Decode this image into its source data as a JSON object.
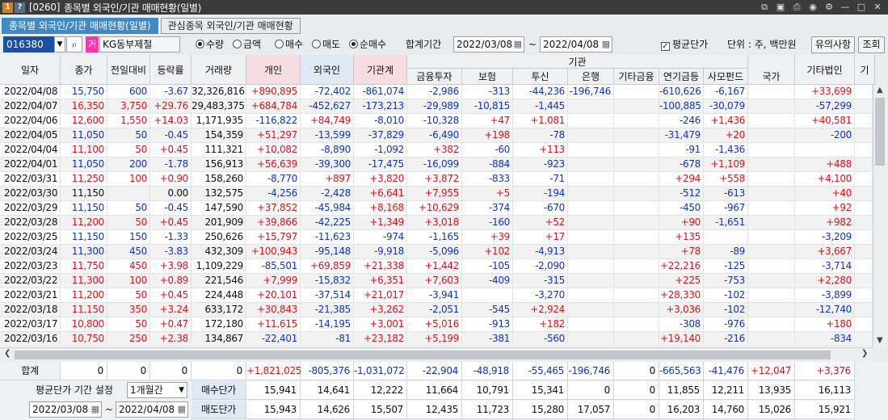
{
  "titlebar": {
    "screen_code": "[0260]",
    "title": "종목별 외국인/기관 매매현황(일별)",
    "icon1": "1",
    "icon2": "?"
  },
  "tabs": [
    "종목별 외국인/기관 매매현황(일별)",
    "관심종목 외국인/기관 매매현황"
  ],
  "toolbar": {
    "code": "016380",
    "mark": "거",
    "stock_name": "KG동부제철",
    "radio_qty": "수량",
    "radio_amt": "금액",
    "radio_buy": "매수",
    "radio_sell": "매도",
    "radio_net": "순매수",
    "period_label": "합계기간",
    "date_from": "2022/03/08",
    "tilde": "~",
    "date_to": "2022/04/08",
    "avg_label": "평균단가",
    "unit_label": "단위 : 주, 백만원",
    "notice_btn": "유의사항",
    "query_btn": "조회"
  },
  "columns": {
    "date": "일자",
    "close": "종가",
    "change": "전일대비",
    "rate": "등락률",
    "volume": "거래량",
    "indiv": "개인",
    "foreign": "외국인",
    "inst_total": "기관계",
    "inst_group": "기관",
    "fin": "금융투자",
    "ins": "보험",
    "trust": "투신",
    "bank": "은행",
    "other_fin": "기타금융",
    "pension": "연기금등",
    "pef": "사모펀드",
    "nation": "국가",
    "other_corp": "기타법인",
    "next": "기"
  },
  "rows": [
    [
      "2022/04/08",
      "15,750",
      "600",
      "-3.67",
      "32,326,816",
      "+890,895",
      "-72,402",
      "-861,074",
      "-2,986",
      "-313",
      "-44,236",
      "-196,746",
      "",
      "-610,626",
      "-6,167",
      "",
      "+33,699"
    ],
    [
      "2022/04/07",
      "16,350",
      "3,750",
      "+29.76",
      "29,483,375",
      "+684,784",
      "-452,627",
      "-173,213",
      "-29,989",
      "-10,815",
      "-1,445",
      "",
      "",
      "-100,885",
      "-30,079",
      "",
      "-57,299"
    ],
    [
      "2022/04/06",
      "12,600",
      "1,550",
      "+14.03",
      "1,171,935",
      "-116,822",
      "+84,749",
      "-8,010",
      "-10,328",
      "+47",
      "+1,081",
      "",
      "",
      "-246",
      "+1,436",
      "",
      "+40,581"
    ],
    [
      "2022/04/05",
      "11,050",
      "50",
      "-0.45",
      "154,359",
      "+51,297",
      "-13,599",
      "-37,829",
      "-6,490",
      "+198",
      "-78",
      "",
      "",
      "-31,479",
      "+20",
      "",
      "-200"
    ],
    [
      "2022/04/04",
      "11,100",
      "50",
      "+0.45",
      "111,321",
      "+10,082",
      "-8,890",
      "-1,092",
      "+382",
      "-60",
      "+113",
      "",
      "",
      "-91",
      "-1,436",
      "",
      ""
    ],
    [
      "2022/04/01",
      "11,050",
      "200",
      "-1.78",
      "156,913",
      "+56,639",
      "-39,300",
      "-17,475",
      "-16,099",
      "-884",
      "-923",
      "",
      "",
      "-678",
      "+1,109",
      "",
      "+488"
    ],
    [
      "2022/03/31",
      "11,250",
      "100",
      "+0.90",
      "158,260",
      "-8,770",
      "+897",
      "+3,820",
      "+3,872",
      "-833",
      "-71",
      "",
      "",
      "+294",
      "+558",
      "",
      "+4,100"
    ],
    [
      "2022/03/30",
      "11,150",
      "",
      "0.00",
      "132,575",
      "-4,256",
      "-2,428",
      "+6,641",
      "+7,955",
      "+5",
      "-194",
      "",
      "",
      "-512",
      "-613",
      "",
      "+40"
    ],
    [
      "2022/03/29",
      "11,150",
      "50",
      "-0.45",
      "147,590",
      "+37,852",
      "-45,984",
      "+8,168",
      "+10,629",
      "-374",
      "-670",
      "",
      "",
      "-450",
      "-967",
      "",
      "+92"
    ],
    [
      "2022/03/28",
      "11,200",
      "50",
      "+0.45",
      "201,909",
      "+39,866",
      "-42,225",
      "+1,349",
      "+3,018",
      "-160",
      "+52",
      "",
      "",
      "+90",
      "-1,651",
      "",
      "+982"
    ],
    [
      "2022/03/25",
      "11,150",
      "150",
      "-1.33",
      "250,626",
      "+15,797",
      "-11,623",
      "-974",
      "-1,165",
      "+39",
      "+17",
      "",
      "",
      "+135",
      "",
      "",
      "-3,209"
    ],
    [
      "2022/03/24",
      "11,300",
      "450",
      "-3.83",
      "432,309",
      "+100,943",
      "-95,148",
      "-9,918",
      "-5,096",
      "+102",
      "-4,913",
      "",
      "",
      "+78",
      "-89",
      "",
      "+3,667"
    ],
    [
      "2022/03/23",
      "11,750",
      "450",
      "+3.98",
      "1,109,229",
      "-85,501",
      "+69,859",
      "+21,338",
      "+1,442",
      "-105",
      "-2,090",
      "",
      "",
      "+22,216",
      "-125",
      "",
      "-3,714"
    ],
    [
      "2022/03/22",
      "11,300",
      "100",
      "+0.89",
      "221,546",
      "+7,999",
      "-15,832",
      "+6,351",
      "+7,603",
      "-409",
      "-315",
      "",
      "",
      "+225",
      "-753",
      "",
      "+2,280"
    ],
    [
      "2022/03/21",
      "11,200",
      "50",
      "+0.45",
      "224,448",
      "+20,101",
      "-37,514",
      "+21,017",
      "-3,941",
      "",
      "-3,270",
      "",
      "",
      "+28,330",
      "-102",
      "",
      "-3,899"
    ],
    [
      "2022/03/18",
      "11,150",
      "350",
      "+3.24",
      "633,172",
      "+30,843",
      "-21,385",
      "+3,262",
      "-2,051",
      "-545",
      "+2,924",
      "",
      "",
      "+3,036",
      "-102",
      "",
      "-12,740"
    ],
    [
      "2022/03/17",
      "10,800",
      "50",
      "+0.47",
      "172,180",
      "+11,615",
      "-14,195",
      "+3,001",
      "+5,016",
      "-913",
      "+182",
      "",
      "",
      "-308",
      "-976",
      "",
      "+180"
    ],
    [
      "2022/03/16",
      "10,750",
      "250",
      "+2.38",
      "134,867",
      "-22,401",
      "-81",
      "+23,182",
      "+5,199",
      "-381",
      "-560",
      "",
      "",
      "+19,140",
      "-216",
      "",
      "-834"
    ]
  ],
  "footer": {
    "total_label": "합계",
    "total": [
      "0",
      "0",
      "0",
      "0",
      "+1,821,025",
      "-805,376",
      "-1,031,072",
      "-22,904",
      "-48,918",
      "-55,465",
      "-196,746",
      "0",
      "-665,563",
      "-41,476",
      "+12,047",
      "+3,376"
    ],
    "avg_period_label": "평균단가 기간 설정",
    "avg_period_value": "1개월간",
    "buy_label": "매수단가",
    "buy": [
      "15,941",
      "14,641",
      "12,222",
      "11,664",
      "10,791",
      "15,341",
      "0",
      "0",
      "11,855",
      "12,211",
      "13,935",
      "16,113"
    ],
    "date_from": "2022/03/08",
    "tilde": "~",
    "date_to": "2022/04/08",
    "sell_label": "매도단가",
    "sell": [
      "15,943",
      "14,626",
      "15,507",
      "12,435",
      "11,723",
      "15,280",
      "17,057",
      "0",
      "16,203",
      "14,760",
      "15,026",
      "15,921"
    ]
  },
  "colors": {
    "up": "#e0121b",
    "down": "#1133cc",
    "tab_active": "#3f89c5"
  }
}
